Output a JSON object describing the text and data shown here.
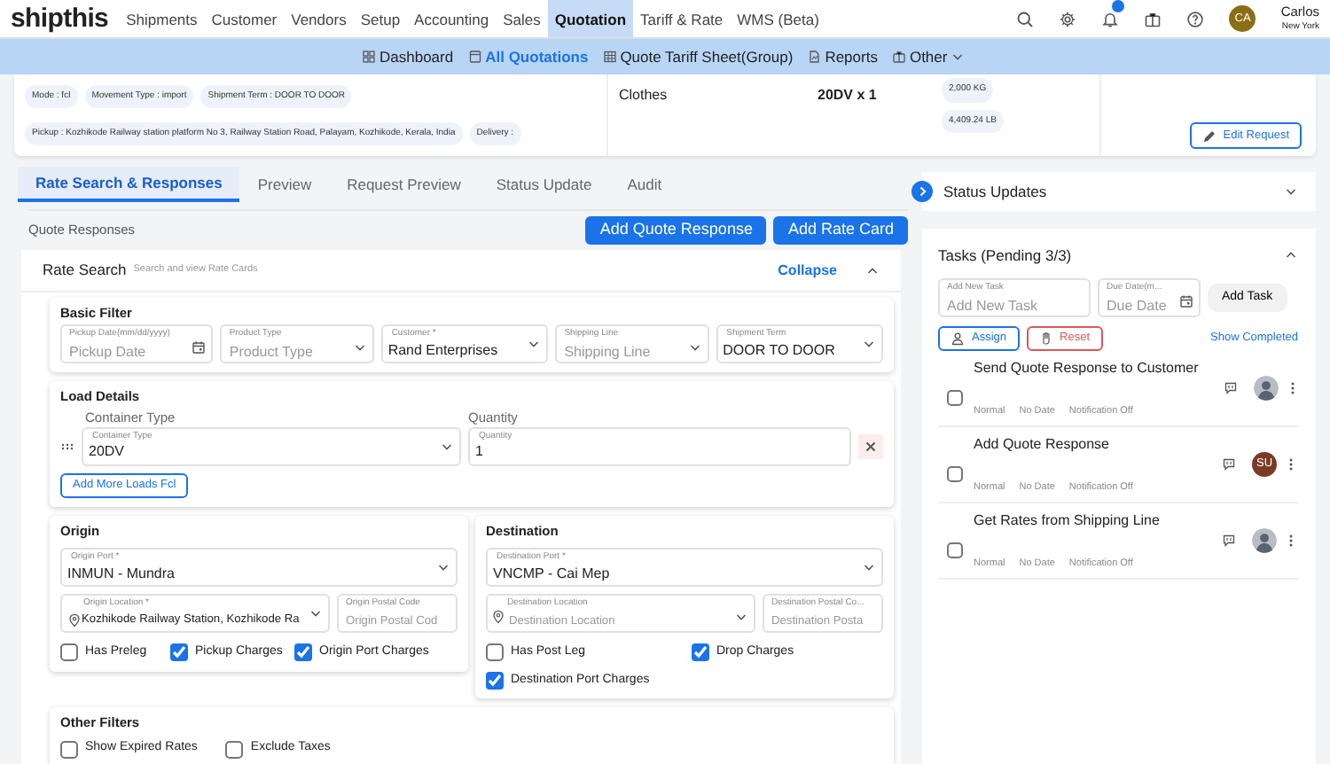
{
  "nav": {
    "logo": "shipthis",
    "items": [
      {
        "label": "Shipments",
        "selected": false
      },
      {
        "label": "Customer",
        "selected": false
      },
      {
        "label": "Vendors",
        "selected": false
      },
      {
        "label": "Setup",
        "selected": false
      },
      {
        "label": "Accounting",
        "selected": false
      },
      {
        "label": "Sales",
        "selected": false
      },
      {
        "label": "Quotation",
        "selected": true
      },
      {
        "label": "Tariff & Rate",
        "selected": false
      },
      {
        "label": "WMS (Beta)",
        "selected": false
      }
    ],
    "user": {
      "initials": "CA",
      "name": "Carlos",
      "location": "New York"
    }
  },
  "subnav": [
    {
      "label": "Dashboard",
      "selected": false
    },
    {
      "label": "All Quotations",
      "selected": true
    },
    {
      "label": "Quote Tariff Sheet(Group)",
      "selected": false
    },
    {
      "label": "Reports",
      "selected": false
    },
    {
      "label": "Other",
      "selected": false
    }
  ],
  "summary": {
    "tags": [
      "Mode : fcl",
      "Movement Type : import",
      "Shipment Term : DOOR TO DOOR"
    ],
    "address_tags": [
      "Pickup : Kozhikode Railway station platform No 3, Railway Station Road, Palayam, Kozhikode, Kerala, India",
      "Delivery :"
    ],
    "commodity": "Clothes",
    "containers": "20DV x 1",
    "weights": [
      "2,000 KG",
      "4,409.24 LB"
    ],
    "edit_button": "Edit Request"
  },
  "tabs": [
    {
      "label": "Rate Search & Responses",
      "selected": true
    },
    {
      "label": "Preview",
      "selected": false
    },
    {
      "label": "Request Preview",
      "selected": false
    },
    {
      "label": "Status Update",
      "selected": false
    },
    {
      "label": "Audit",
      "selected": false
    }
  ],
  "quote_responses": {
    "title": "Quote Responses",
    "buttons": [
      "Add Quote Response",
      "Add Rate Card"
    ]
  },
  "rate_search": {
    "title": "Rate Search",
    "subtitle": "Search and view Rate Cards",
    "collapse": "Collapse",
    "basic_filter": {
      "title": "Basic Filter",
      "fields": [
        {
          "kind": "date",
          "label": "Pickup Date(mm/dd/yyyy)",
          "placeholder": "Pickup Date"
        },
        {
          "kind": "select",
          "label": "Product Type",
          "placeholder": "Product Type"
        },
        {
          "kind": "select",
          "label": "Customer *",
          "value": "Rand Enterprises"
        },
        {
          "kind": "select",
          "label": "Shipping Line",
          "placeholder": "Shipping Line"
        },
        {
          "kind": "select",
          "label": "Shipment Term",
          "value": "DOOR TO DOOR"
        }
      ]
    },
    "load_details": {
      "title": "Load Details",
      "columns": [
        "Container Type",
        "Quantity"
      ],
      "row": {
        "container": {
          "label": "Container Type",
          "value": "20DV"
        },
        "quantity": {
          "label": "Quantity",
          "value": "1"
        }
      },
      "add_button": "Add More Loads Fcl"
    },
    "origin": {
      "title": "Origin",
      "port": {
        "label": "Origin Port *",
        "value": "INMUN - Mundra"
      },
      "location": {
        "label": "Origin Location *",
        "value": "Kozhikode Railway Station, Kozhikode Ra"
      },
      "postal": {
        "label": "Origin Postal Code",
        "placeholder": "Origin Postal Cod"
      },
      "checks": [
        {
          "label": "Has Preleg",
          "checked": false
        },
        {
          "label": "Pickup Charges",
          "checked": true
        },
        {
          "label": "Origin Port Charges",
          "checked": true
        }
      ]
    },
    "destination": {
      "title": "Destination",
      "port": {
        "label": "Destination Port *",
        "value": "VNCMP - Cai Mep"
      },
      "location": {
        "label": "Destination Location",
        "placeholder": "Destination Location"
      },
      "postal": {
        "label": "Destination Postal Co...",
        "placeholder": "Destination Posta"
      },
      "checks": [
        {
          "label": "Has Post Leg",
          "checked": false
        },
        {
          "label": "Drop Charges",
          "checked": true
        },
        {
          "label": "Destination Port Charges",
          "checked": true
        }
      ]
    },
    "other_filters": {
      "title": "Other Filters",
      "checks": [
        {
          "label": "Show Expired Rates",
          "checked": false
        },
        {
          "label": "Exclude Taxes",
          "checked": false
        }
      ]
    }
  },
  "status_updates": {
    "title": "Status Updates"
  },
  "tasks": {
    "title": "Tasks (Pending 3/3)",
    "new_task": {
      "label": "Add New Task",
      "placeholder": "Add New Task"
    },
    "due_date": {
      "label": "Due Date(m...",
      "placeholder": "Due Date"
    },
    "add_button": "Add Task",
    "assign_button": "Assign",
    "reset_button": "Reset",
    "show_completed": "Show Completed",
    "items": [
      {
        "title": "Send Quote Response to Customer",
        "checked": false,
        "priority": "Normal",
        "date": "No Date",
        "notification": "Notification Off",
        "assignee": {
          "kind": "photo"
        }
      },
      {
        "title": "Add Quote Response",
        "checked": false,
        "priority": "Normal",
        "date": "No Date",
        "notification": "Notification Off",
        "assignee": {
          "kind": "initials",
          "initials": "SU"
        }
      },
      {
        "title": "Get Rates from Shipping Line",
        "checked": false,
        "priority": "Normal",
        "date": "No Date",
        "notification": "Notification Off",
        "assignee": {
          "kind": "photo"
        }
      }
    ]
  }
}
